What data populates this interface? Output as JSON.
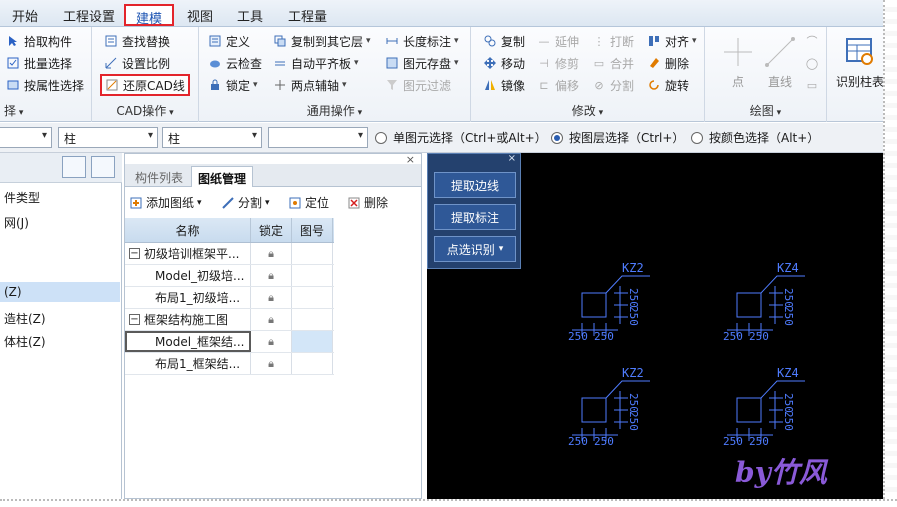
{
  "menu": {
    "items": [
      "开始",
      "工程设置",
      "建模",
      "视图",
      "工具",
      "工程量"
    ],
    "active": "建模"
  },
  "ribbon": {
    "select_group": {
      "label": "择",
      "items": [
        "拾取构件",
        "批量选择",
        "按属性选择"
      ]
    },
    "cad_group": {
      "label": "CAD操作",
      "items": [
        "查找替换",
        "设置比例",
        "还原CAD线"
      ]
    },
    "common_group": {
      "label": "通用操作",
      "col1": [
        "定义",
        "云检查",
        "锁定"
      ],
      "col2": [
        "复制到其它层",
        "自动平齐板",
        "两点辅轴"
      ],
      "col3": [
        "长度标注",
        "图元存盘",
        "图元过滤"
      ]
    },
    "modify_group": {
      "label": "修改",
      "col1": [
        "复制",
        "移动",
        "镜像"
      ],
      "col2": [
        "延伸",
        "修剪",
        "偏移"
      ],
      "col3": [
        "打断",
        "合并",
        "分割"
      ],
      "col4": [
        "对齐",
        "删除",
        "旋转"
      ]
    },
    "draw_group": {
      "label": "绘图",
      "items": [
        "点",
        "直线"
      ]
    },
    "identify_label": "识别柱表"
  },
  "filterbar": {
    "combo1": "",
    "combo2": "柱",
    "combo3": "柱",
    "combo4": "",
    "radios": [
      "单图元选择（Ctrl+或Alt+）",
      "按图层选择（Ctrl+）",
      "按颜色选择（Alt+）"
    ],
    "selected_radio": 1
  },
  "leftpanel": {
    "items": [
      "件类型",
      "网(J)",
      "(Z)",
      "造柱(Z)",
      "体柱(Z)"
    ],
    "selected": 2
  },
  "drawings": {
    "tabs": [
      "构件列表",
      "图纸管理"
    ],
    "active_tab": 1,
    "toolbar": [
      "添加图纸",
      "分割",
      "定位",
      "删除"
    ],
    "columns": [
      "名称",
      "锁定",
      "图号"
    ],
    "rows": [
      {
        "name": "初级培训框架平...",
        "level": 0,
        "expander": "−"
      },
      {
        "name": "Model_初级培...",
        "level": 1
      },
      {
        "name": "布局1_初级培...",
        "level": 1
      },
      {
        "name": "框架结构施工图",
        "level": 0,
        "expander": "−"
      },
      {
        "name": "Model_框架结...",
        "level": 1,
        "selected": true
      },
      {
        "name": "布局1_框架结...",
        "level": 1
      }
    ]
  },
  "canvas": {
    "float_buttons": [
      "提取边线",
      "提取标注",
      "点选识别"
    ],
    "columns": [
      {
        "label": "KZ2",
        "dim_x": "250",
        "dim_x2": "250",
        "dim_y": "250",
        "dim_y2": "250"
      },
      {
        "label": "KZ4",
        "dim_x": "250",
        "dim_x2": "250",
        "dim_y": "250",
        "dim_y2": "250"
      },
      {
        "label": "KZ2",
        "dim_x": "250",
        "dim_x2": "250",
        "dim_y": "250",
        "dim_y2": "250"
      },
      {
        "label": "KZ4",
        "dim_x": "250",
        "dim_x2": "250",
        "dim_y": "250",
        "dim_y2": "250"
      }
    ],
    "watermark": "by竹风"
  },
  "colors": {
    "highlight_red": "#e3242b",
    "cad_blue": "#4f7cff",
    "canvas_bg": "#000000",
    "panel_blue": "#24416e"
  }
}
